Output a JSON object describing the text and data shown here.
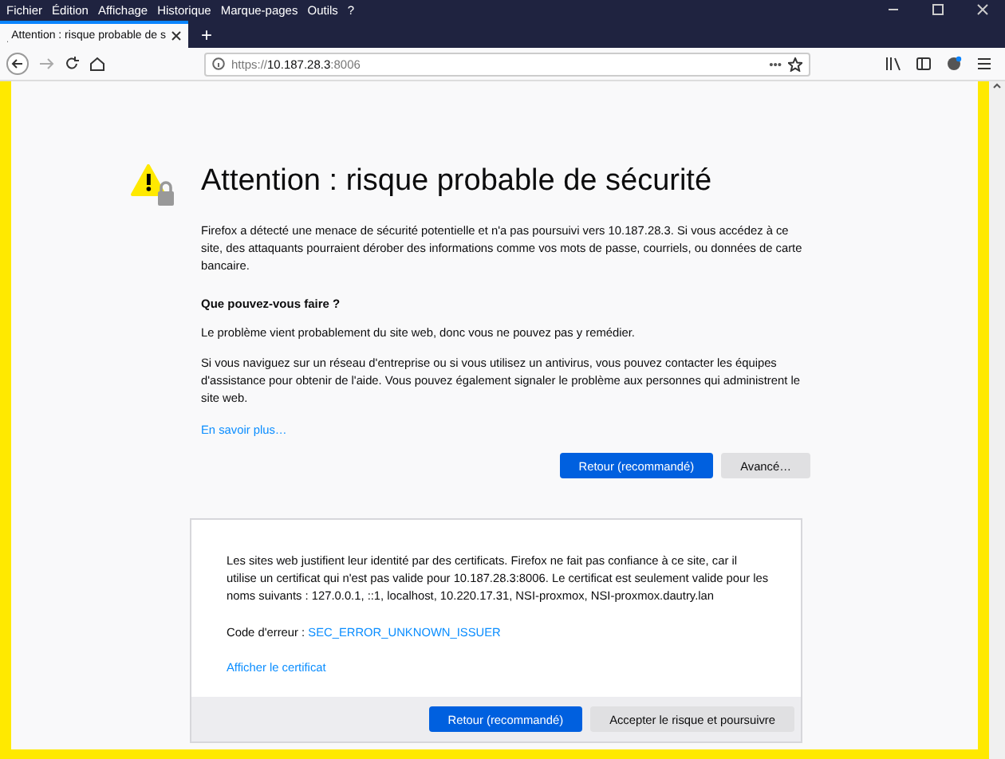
{
  "menu_bar": [
    "Fichier",
    "Édition",
    "Affichage",
    "Historique",
    "Marque-pages",
    "Outils",
    "?"
  ],
  "tabs": [
    {
      "title": "Attention : risque probable de s",
      "selected": true
    }
  ],
  "new_tab": "+",
  "address_bar": {
    "scheme": "https://",
    "host": "10.187.28.3",
    "port": ":8006",
    "more": "•••"
  },
  "page": {
    "title": "Attention : risque probable de sécurité",
    "intro": "Firefox a détecté une menace de sécurité potentielle et n'a pas poursuivi vers 10.187.28.3. Si vous accédez à ce site, des attaquants pourraient dérober des informations comme vos mots de passe, courriels, ou données de carte bancaire.",
    "subtitle": "Que pouvez-vous faire ?",
    "paragraphs": [
      "Le problème vient probablement du site web, donc vous ne pouvez pas y remédier.",
      "Si vous naviguez sur un réseau d'entreprise ou si vous utilisez un antivirus, vous pouvez contacter les équipes d'assistance pour obtenir de l'aide. Vous pouvez également signaler le problème aux personnes qui administrent le site web."
    ],
    "learn_more": "En savoir plus…",
    "buttons": [
      {
        "label": "Retour (recommandé)",
        "kind": "primary"
      },
      {
        "label": "Avancé…",
        "kind": "secondary"
      }
    ]
  },
  "advanced": {
    "text": "Les sites web justifient leur identité par des certificats. Firefox ne fait pas confiance à ce site, car il utilise un certificat qui n'est pas valide pour 10.187.28.3:8006. Le certificat est seulement valide pour les noms suivants : 127.0.0.1, ::1, localhost, 10.220.17.31, NSI-proxmox, NSI-proxmox.dautry.lan",
    "error_label": "Code d'erreur :",
    "error_code": "SEC_ERROR_UNKNOWN_ISSUER",
    "view_certificate": "Afficher le certificat",
    "buttons": [
      {
        "label": "Retour (recommandé)",
        "kind": "primary"
      },
      {
        "label": "Accepter le risque et poursuivre",
        "kind": "secondary"
      }
    ]
  }
}
